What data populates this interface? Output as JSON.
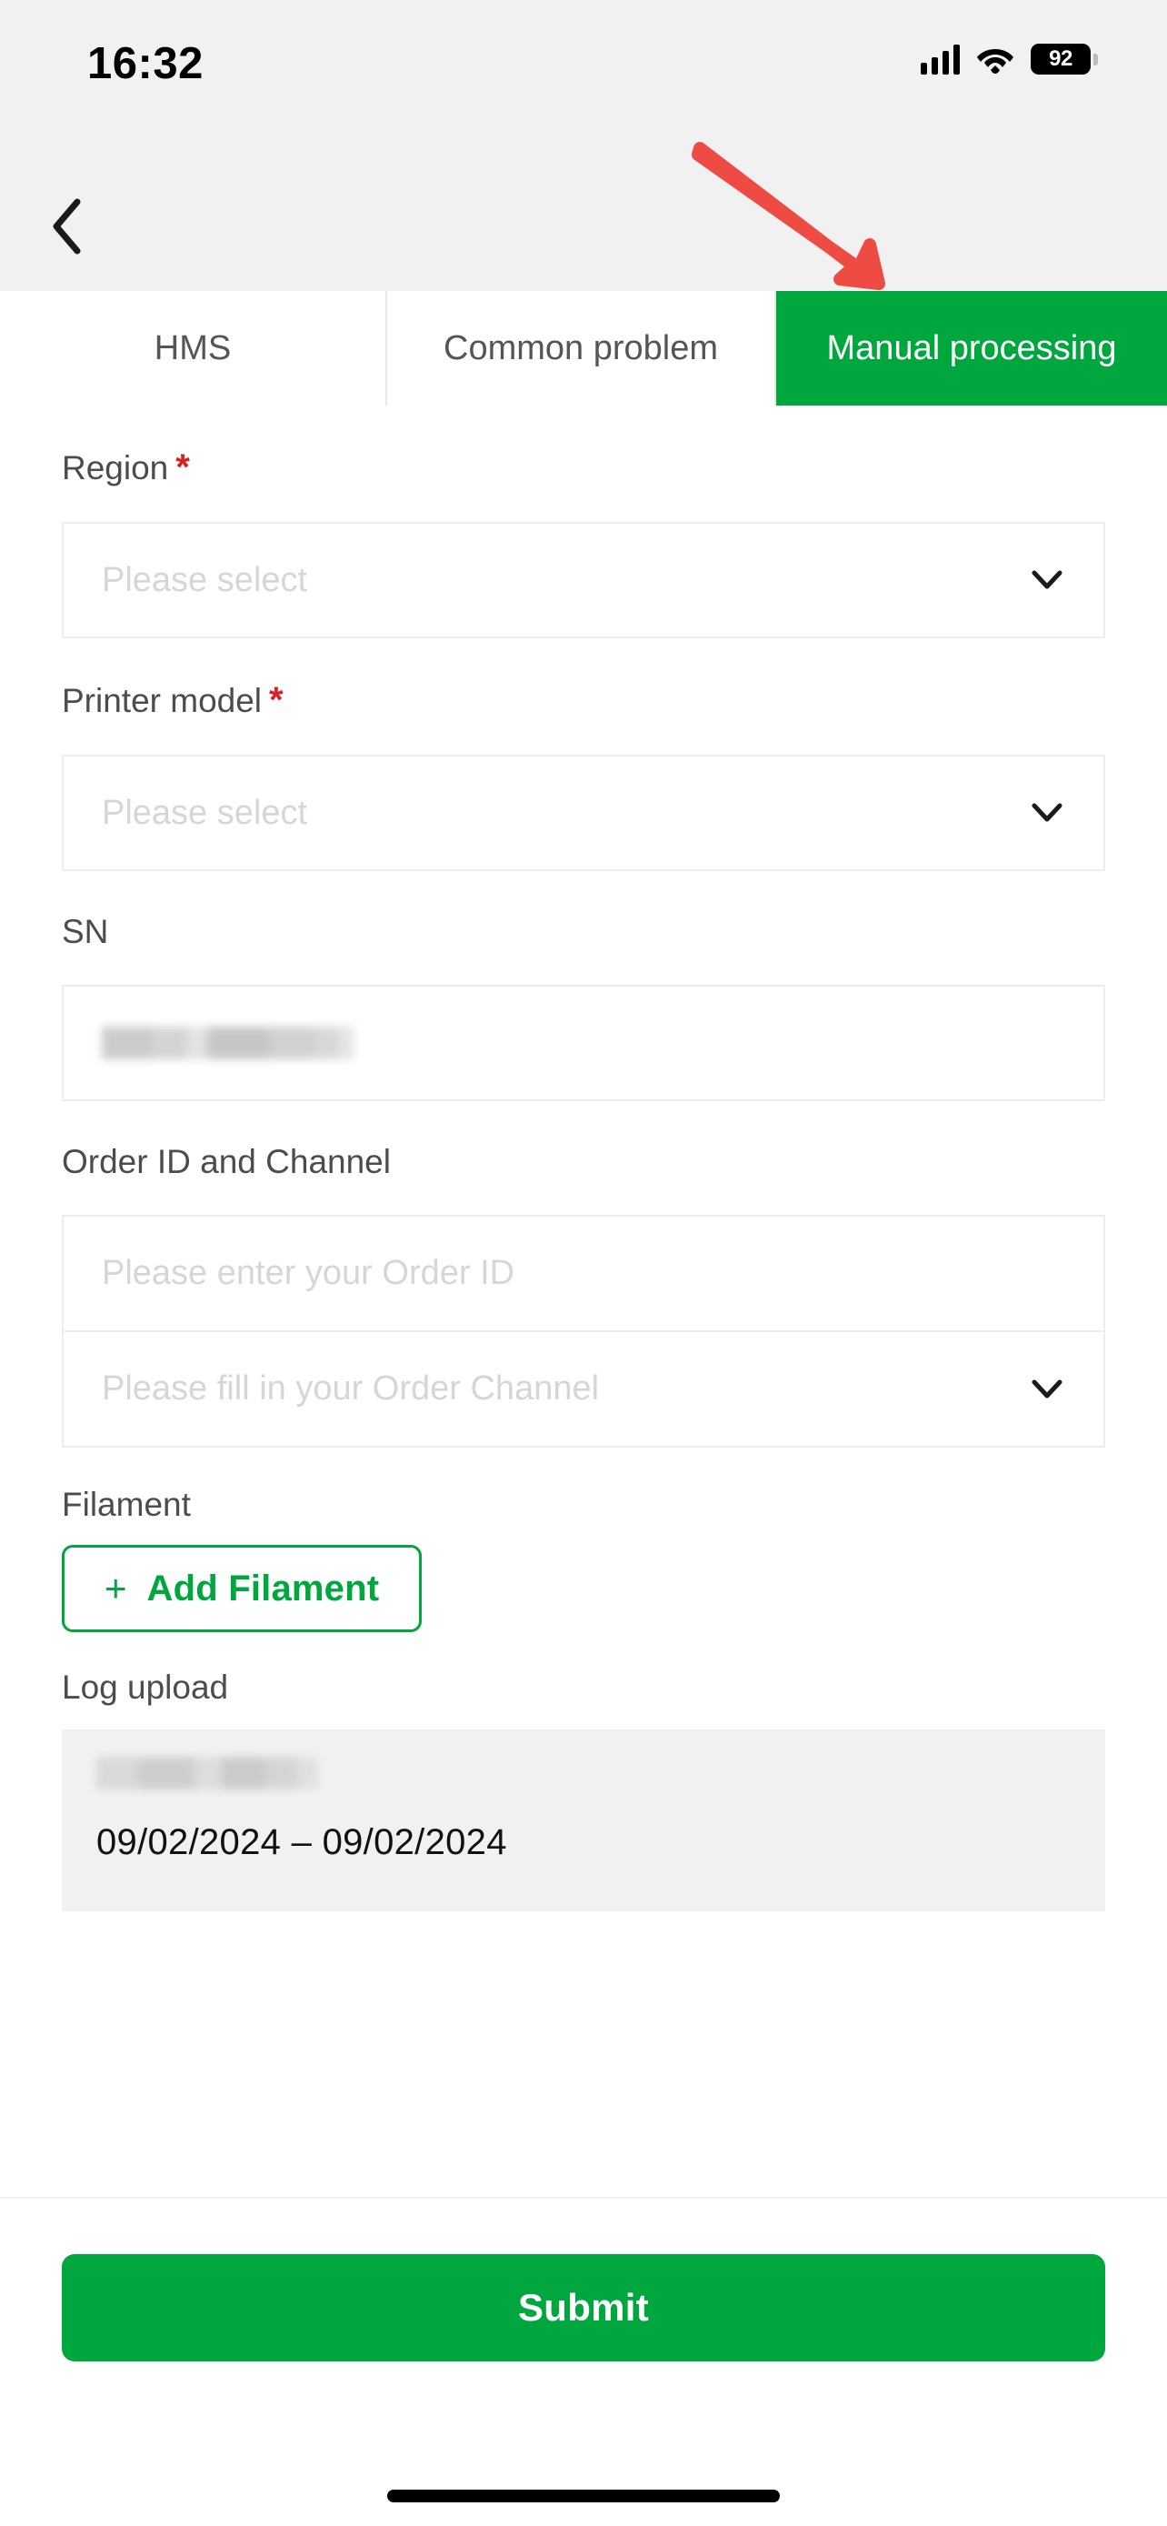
{
  "status_bar": {
    "time": "16:32",
    "battery_percent": "92",
    "icons": [
      "cellular-signal-icon",
      "wifi-icon",
      "battery-icon"
    ]
  },
  "nav": {
    "back_icon": "chevron-left-icon"
  },
  "tabs": [
    {
      "label": "HMS",
      "active": false
    },
    {
      "label": "Common problem",
      "active": false
    },
    {
      "label": "Manual processing",
      "active": true
    }
  ],
  "form": {
    "region": {
      "label": "Region",
      "required_mark": "*",
      "placeholder": "Please select",
      "value": "",
      "chevron": "chevron-down-icon"
    },
    "printer_model": {
      "label": "Printer model",
      "required_mark": "*",
      "placeholder": "Please select",
      "value": "",
      "chevron": "chevron-down-icon"
    },
    "sn": {
      "label": "SN",
      "placeholder": "",
      "value_redacted": true
    },
    "order": {
      "label": "Order ID and Channel",
      "id_placeholder": "Please enter your Order ID",
      "id_value": "",
      "channel_placeholder": "Please fill in your Order Channel",
      "channel_value": "",
      "chevron": "chevron-down-icon"
    },
    "filament": {
      "label": "Filament",
      "add_button_plus": "+",
      "add_button_label": "Add Filament"
    },
    "log_upload": {
      "label": "Log upload",
      "file_name_redacted": true,
      "date_range": "09/02/2024 – 09/02/2024"
    }
  },
  "footer": {
    "submit_label": "Submit"
  },
  "annotation": {
    "type": "arrow",
    "color": "#ee4b44",
    "points_to": "Manual processing"
  },
  "colors": {
    "brand_green": "#00a63e",
    "required_red": "#d82020",
    "annotation_red": "#ee4b44",
    "header_bg": "#f1f1f1",
    "card_bg": "#f1f1f1",
    "border": "#ededed",
    "placeholder": "#d6d6d6",
    "label": "#4c4c4c"
  }
}
